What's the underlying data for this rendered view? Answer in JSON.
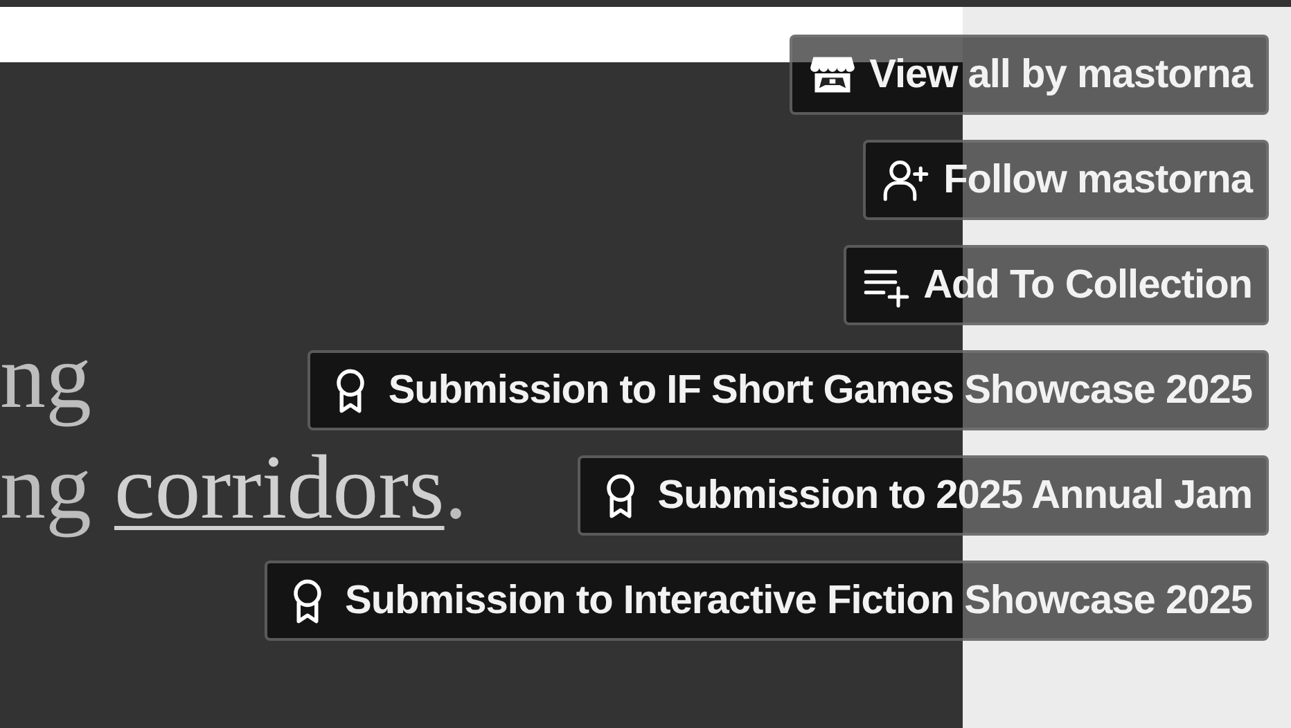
{
  "intro": {
    "line_1": "ng",
    "line_2_before": "ng ",
    "line_2_link": "corridors",
    "line_2_after": "."
  },
  "actions": [
    {
      "kind": "store",
      "label": "View all by mastorna"
    },
    {
      "kind": "follow",
      "label": "Follow mastorna"
    },
    {
      "kind": "collection",
      "label": "Add To Collection"
    },
    {
      "kind": "jam",
      "label": "Submission to IF Short Games Showcase 2025"
    },
    {
      "kind": "jam",
      "label": "Submission to 2025 Annual Jam"
    },
    {
      "kind": "jam",
      "label": "Submission to Interactive Fiction Showcase 2025"
    }
  ]
}
